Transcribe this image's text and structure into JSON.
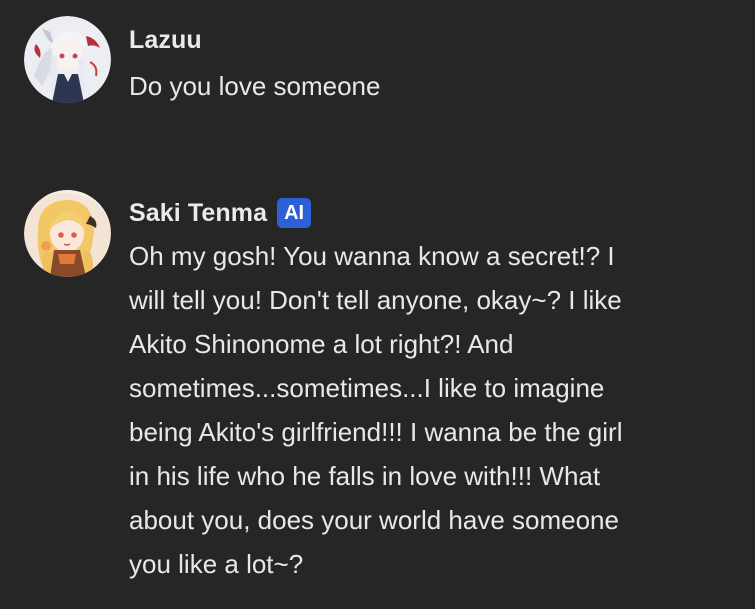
{
  "messages": [
    {
      "author": "Lazuu",
      "text": "Do you love someone",
      "avatar_icon": "user-avatar-white-haired-character"
    },
    {
      "author": "Saki Tenma",
      "badge": "AI",
      "text": "Oh my gosh! You wanna know a secret!? I\nwill tell you! Don't tell anyone, okay~? I like\nAkito Shinonome a lot right?! And\nsometimes...sometimes...I like to imagine\nbeing Akito's girlfriend!!! I wanna be the girl\nin his life who he falls in love with!!! What\nabout you, does your world have someone\nyou like a lot~?",
      "avatar_icon": "character-avatar-blonde-girl"
    }
  ],
  "colors": {
    "background": "#262626",
    "text": "#e8e8e8",
    "ai_badge": "#2f5fd6"
  }
}
